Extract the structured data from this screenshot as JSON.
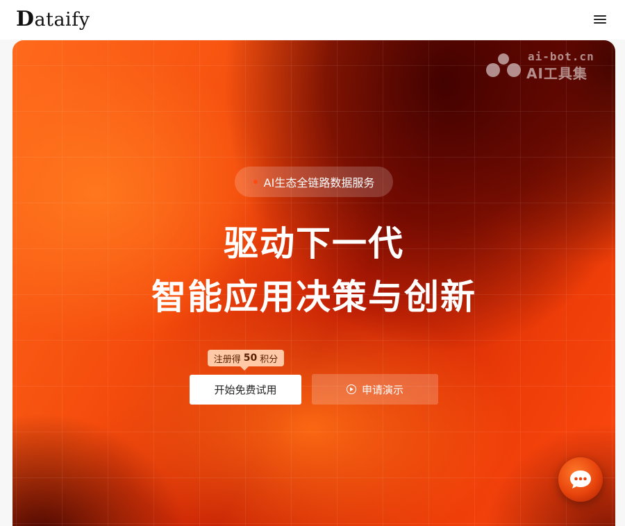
{
  "header": {
    "logo_initial": "D",
    "logo_rest": "ataify"
  },
  "watermark": {
    "domain": "ai-bot.cn",
    "name": "AI工具集"
  },
  "hero": {
    "pill_text": "AI生态全链路数据服务",
    "headline_line1": "驱动下一代",
    "headline_line2": "智能应用决策与创新",
    "badge_prefix": "注册得",
    "badge_points": "50",
    "badge_suffix": "积分",
    "primary_button": "开始免费试用",
    "secondary_button": "申请演示"
  },
  "icons": {
    "menu": "hamburger-menu-icon",
    "play": "play-circle-icon",
    "chat": "chat-bubble-icon"
  },
  "colors": {
    "accent": "#ff4a10",
    "badge_bg": "#ffc9a8",
    "dark_red": "#3c0000"
  }
}
